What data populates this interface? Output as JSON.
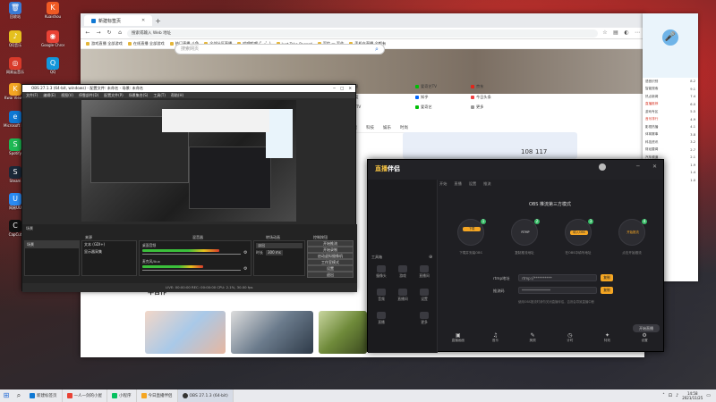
{
  "desktop": {
    "icons": [
      {
        "label": "回收站",
        "color": "#3a7bd5",
        "glyph": "🗑"
      },
      {
        "label": "Kuaishou",
        "color": "#f05a24",
        "glyph": "K"
      },
      {
        "label": "QQ音乐",
        "color": "#e5c01e",
        "glyph": "♪"
      },
      {
        "label": "Google Chrome",
        "color": "#e94235",
        "glyph": "◉"
      },
      {
        "label": "网易云音乐",
        "color": "#d83a2a",
        "glyph": "◎"
      },
      {
        "label": "QQ",
        "color": "#1296db",
        "glyph": "Q"
      },
      {
        "label": "Kwai Viewer",
        "color": "#f5a623",
        "glyph": "K"
      },
      {
        "label": "Microsoft Edge",
        "color": "#0f78d4",
        "glyph": "e"
      },
      {
        "label": "NVIDIA",
        "color": "#76b900",
        "glyph": "N"
      },
      {
        "label": "GeForce",
        "color": "#333",
        "glyph": "G"
      },
      {
        "label": "OBS",
        "color": "#222",
        "glyph": "●"
      },
      {
        "label": "微信",
        "color": "#07c160",
        "glyph": "W"
      },
      {
        "label": "Spotify",
        "color": "#1db954",
        "glyph": "S"
      },
      {
        "label": "Steam",
        "color": "#1b2838",
        "glyph": "S"
      },
      {
        "label": "网易UU",
        "color": "#2a8bf2",
        "glyph": "U"
      },
      {
        "label": "CapCut",
        "color": "#111",
        "glyph": "C"
      }
    ]
  },
  "browser": {
    "tab_title": "新建标签页",
    "url": "搜索或输入 Web 地址",
    "bookmarks": [
      "游戏直播 全部游戏",
      "在线直播 全部游戏",
      "热门直播 斗鱼",
      "全部分区直播",
      "哔哩哔哩 (゜-゜)",
      "Just Take Record",
      "写信 — 写作",
      "手机在直播 全都有"
    ],
    "search_placeholder": "搜索网页",
    "sites": [
      {
        "label": "网易",
        "color": "#d83a2a"
      },
      {
        "label": "爱奇艺TV",
        "color": "#00be06"
      },
      {
        "label": "京东",
        "color": "#e1251b"
      },
      {
        "label": "百度",
        "color": "#2932e1"
      },
      {
        "label": "知乎",
        "color": "#0066ff"
      },
      {
        "label": "今日头条",
        "color": "#f04142"
      },
      {
        "label": "CCTV",
        "color": "#c8102e"
      },
      {
        "label": "爱奇艺",
        "color": "#00be06"
      },
      {
        "label": "更多",
        "color": "#999"
      }
    ],
    "newsbar": [
      "推荐",
      "新闻",
      "体育",
      "汽车",
      "游戏",
      "科技",
      "娱乐",
      "时尚"
    ],
    "weather_a": "108",
    "weather_b": "117",
    "lower_title": "华合作"
  },
  "obs": {
    "title": "OBS 27.1.3 (64-bit, windows) - 配置文件: 未命名 - 场景: 未命名",
    "menu": [
      "文件(F)",
      "编辑(E)",
      "视图(V)",
      "停靠部件(D)",
      "配置文件(P)",
      "场景集合(S)",
      "工具(T)",
      "帮助(H)"
    ],
    "docks": [
      "场景",
      "来源",
      "混音器",
      "转场动画",
      "控制按钮"
    ],
    "scene_item": "场景",
    "sources": [
      "文本 (GDI+)",
      "显示器采集"
    ],
    "mixer": [
      {
        "label": "桌面音频",
        "level": 0.78
      },
      {
        "label": "麦克风/Aux",
        "level": 0.62
      }
    ],
    "transition": "淡出",
    "duration_label": "时长",
    "duration": "300 ms",
    "controls": [
      "开始推流",
      "开始录制",
      "启动虚拟摄像机",
      "工作室模式",
      "设置",
      "退出"
    ],
    "status": "LIVE: 00:00:00   REC: 00:00:00   CPU: 2.1%, 30.00 fps"
  },
  "zhibo": {
    "logo_a": "直播",
    "logo_b": "伴侣",
    "tabs": [
      "开始",
      "直播",
      "设置",
      "推流"
    ],
    "sidebar_items": [
      "摄像头",
      "游戏",
      "直播间",
      "音频",
      "直播间",
      "设置",
      "直播",
      "更多"
    ],
    "left_section_label": "工具箱",
    "mode_title": "OBS 推流第三方模式",
    "steps": [
      {
        "pill": "下载",
        "label": "下载并安装OBS",
        "badge": "1"
      },
      {
        "pill": "RTMP",
        "label": "复制推流地址",
        "badge": "2"
      },
      {
        "pill": "填入OBS",
        "label": "在OBS中填写地址",
        "badge": "3"
      },
      {
        "pill": "开始推流",
        "label": "点击开始推流",
        "badge": "4"
      }
    ],
    "stream_url_label": "rtmp地址",
    "stream_url": "rtmp://**********",
    "stream_key_label": "推流码",
    "stream_key": "****************",
    "copy_label": "复制",
    "note": "使用OBS推流时请勿关闭直播伴侣，否则会导致直播中断",
    "tools": [
      {
        "glyph": "▣",
        "label": "直播画面"
      },
      {
        "glyph": "♫",
        "label": "音乐"
      },
      {
        "glyph": "✎",
        "label": "美颜"
      },
      {
        "glyph": "◷",
        "label": "计时"
      },
      {
        "glyph": "✦",
        "label": "特效"
      },
      {
        "glyph": "⚙",
        "label": "设置"
      }
    ],
    "start_label": "开始直播"
  },
  "rpanel": {
    "rows": [
      {
        "a": "语音识别",
        "b": "8.2"
      },
      {
        "a": "智能搜索",
        "b": "9.1"
      },
      {
        "a": "热点新闻",
        "b": "7.4"
      },
      {
        "a": "直播推荐",
        "b": "6.0",
        "red": true
      },
      {
        "a": "游戏专区",
        "b": "5.5"
      },
      {
        "a": "音乐排行",
        "b": "4.9",
        "red": true
      },
      {
        "a": "影视热播",
        "b": "4.1"
      },
      {
        "a": "体育赛事",
        "b": "3.8"
      },
      {
        "a": "科技资讯",
        "b": "3.2"
      },
      {
        "a": "财经要闻",
        "b": "2.7"
      },
      {
        "a": "汽车频道",
        "b": "2.1"
      },
      {
        "a": "旅游攻略",
        "b": "1.9"
      },
      {
        "a": "美食推荐",
        "b": "1.4"
      },
      {
        "a": "更多内容",
        "b": "1.0"
      }
    ]
  },
  "taskbar": {
    "items": [
      {
        "label": "新建标签页",
        "color": "#0f78d4"
      },
      {
        "label": "一人一剑的小屋",
        "color": "#e94235"
      },
      {
        "label": "小程序",
        "color": "#07c160"
      },
      {
        "label": "今日直播伴侣",
        "color": "#f5a623"
      },
      {
        "label": "OBS 27.1.3 (64-bit)",
        "color": "#333"
      }
    ],
    "time": "14:58",
    "date": "2021/11/25"
  }
}
